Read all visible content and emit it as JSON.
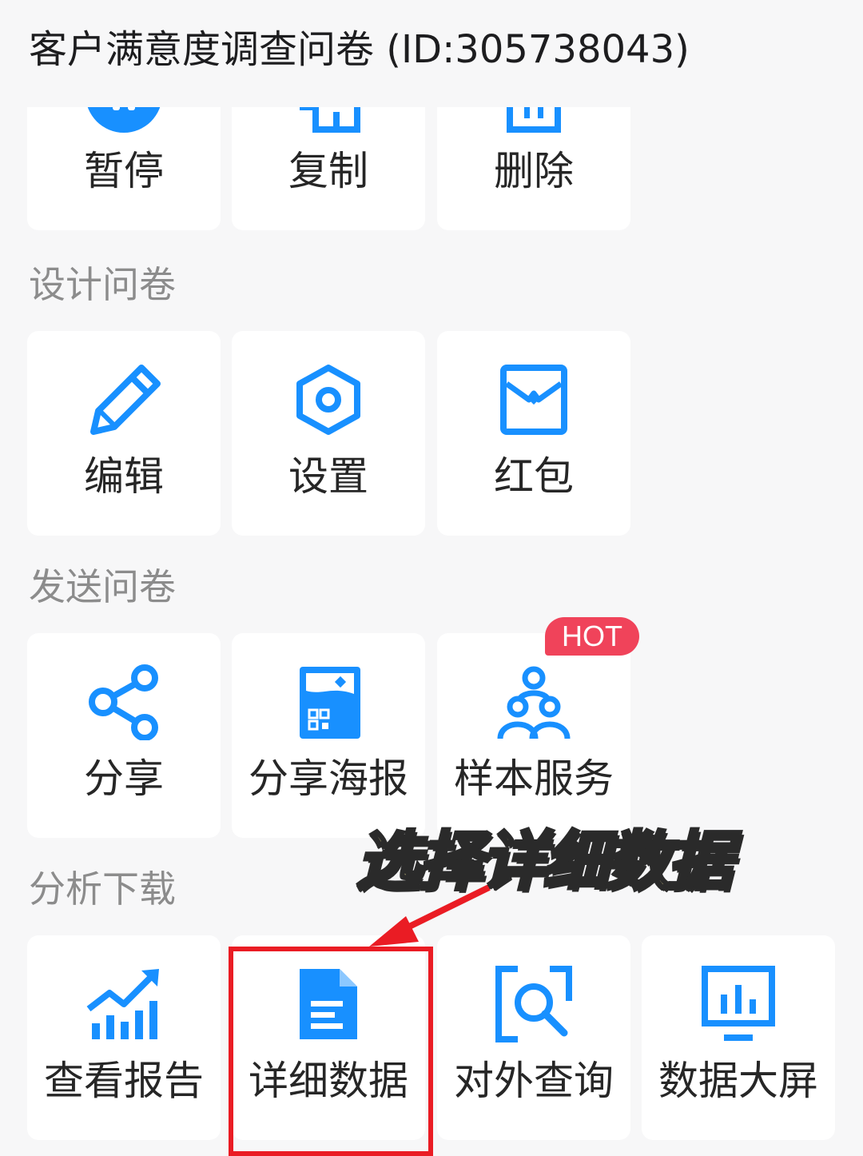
{
  "header": {
    "title": "客户满意度调查问卷 (ID:305738043)"
  },
  "top_row": {
    "items": [
      {
        "label": "暂停",
        "icon": "pause-icon"
      },
      {
        "label": "复制",
        "icon": "copy-icon"
      },
      {
        "label": "删除",
        "icon": "delete-icon"
      }
    ]
  },
  "sections": {
    "design": {
      "title": "设计问卷",
      "items": [
        {
          "label": "编辑",
          "icon": "pencil-icon"
        },
        {
          "label": "设置",
          "icon": "hexagon-settings-icon"
        },
        {
          "label": "红包",
          "icon": "red-envelope-icon"
        }
      ]
    },
    "send": {
      "title": "发送问卷",
      "items": [
        {
          "label": "分享",
          "icon": "share-icon"
        },
        {
          "label": "分享海报",
          "icon": "poster-qr-icon"
        },
        {
          "label": "样本服务",
          "icon": "users-group-icon",
          "badge": "HOT"
        }
      ]
    },
    "analyze": {
      "title": "分析下载",
      "items": [
        {
          "label": "查看报告",
          "icon": "trend-chart-icon"
        },
        {
          "label": "详细数据",
          "icon": "document-icon"
        },
        {
          "label": "对外查询",
          "icon": "search-frame-icon"
        },
        {
          "label": "数据大屏",
          "icon": "monitor-chart-icon"
        }
      ]
    }
  },
  "annotation": {
    "text": "选择详细数据"
  },
  "colors": {
    "accent": "#1890ff",
    "badge": "#f0435a",
    "highlight": "#ea1c24",
    "annotation_fill": "#f7ec9f"
  }
}
